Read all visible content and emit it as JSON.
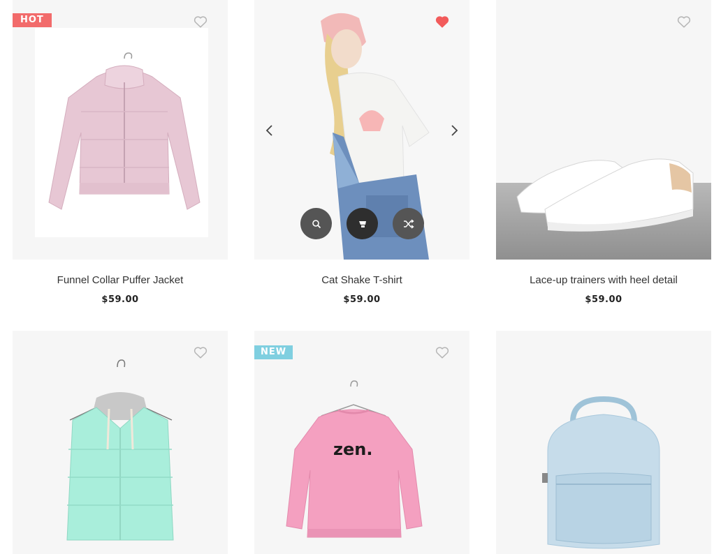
{
  "colors": {
    "hot_badge": "#f26b6b",
    "new_badge": "#7fcfe0",
    "heart_active": "#f25b5b",
    "heart_outline": "#b5b5b5",
    "action_dark": "#2e2e2e",
    "action_mid": "#555555"
  },
  "products": [
    {
      "title": "Funnel Collar Puffer Jacket",
      "price": "$59.00",
      "badge": "HOT",
      "wishlisted": false,
      "image": "pink-puffer-jacket"
    },
    {
      "title": "Cat Shake T-shirt",
      "price": "$59.00",
      "badge": "",
      "wishlisted": true,
      "image": "model-tshirt-overalls",
      "actions": [
        "search-icon",
        "cart-icon",
        "shuffle-icon"
      ],
      "carousel": [
        "chevron-left-icon",
        "chevron-right-icon"
      ]
    },
    {
      "title": "Lace-up trainers with heel detail",
      "price": "$59.00",
      "badge": "",
      "wishlisted": false,
      "image": "white-sneakers"
    },
    {
      "title": "",
      "price": "",
      "badge": "",
      "wishlisted": false,
      "image": "mint-puffer-vest"
    },
    {
      "title": "",
      "price": "",
      "badge": "NEW",
      "wishlisted": false,
      "image": "pink-zen-sweatshirt",
      "print_text": "zen."
    },
    {
      "title": "",
      "price": "",
      "badge": "",
      "wishlisted": false,
      "image": "silver-backpack"
    }
  ]
}
